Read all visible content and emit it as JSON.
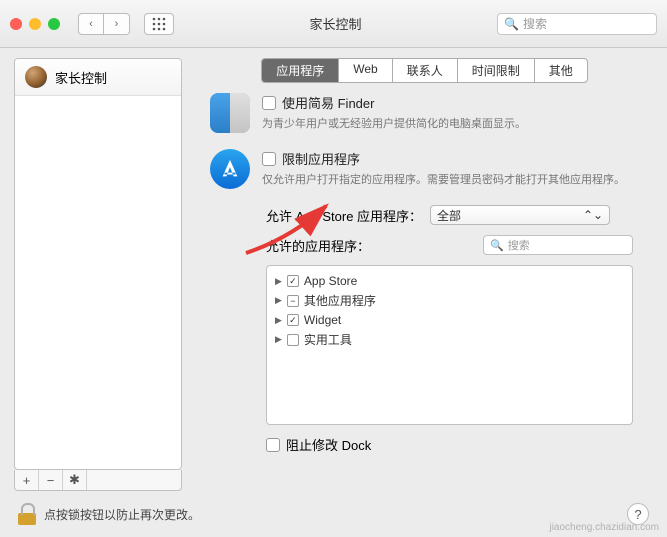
{
  "window": {
    "title": "家长控制"
  },
  "toolbar": {
    "search_placeholder": "搜索"
  },
  "sidebar": {
    "user_label": "家长控制",
    "add": "+",
    "remove": "−",
    "gear": "✱"
  },
  "tabs": [
    {
      "label": "应用程序",
      "active": true
    },
    {
      "label": "Web"
    },
    {
      "label": "联系人"
    },
    {
      "label": "时间限制"
    },
    {
      "label": "其他"
    }
  ],
  "options": {
    "simple_finder": {
      "label": "使用简易 Finder",
      "desc": "为青少年用户或无经验用户提供简化的电脑桌面显示。"
    },
    "limit_apps": {
      "label": "限制应用程序",
      "desc": "仅允许用户打开指定的应用程序。需要管理员密码才能打开其他应用程序。"
    }
  },
  "appstore_row": {
    "label": "允许 App Store 应用程序：",
    "value": "全部"
  },
  "allowed_apps": {
    "label": "允许的应用程序：",
    "search_placeholder": "搜索",
    "tree": [
      {
        "label": "App Store",
        "state": "checked"
      },
      {
        "label": "其他应用程序",
        "state": "mixed"
      },
      {
        "label": "Widget",
        "state": "checked"
      },
      {
        "label": "实用工具",
        "state": "unchecked"
      }
    ]
  },
  "dock": {
    "label": "阻止修改 Dock"
  },
  "lock": {
    "text": "点按锁按钮以防止再次更改。"
  },
  "watermark": "jiaocheng.chazidian.com"
}
